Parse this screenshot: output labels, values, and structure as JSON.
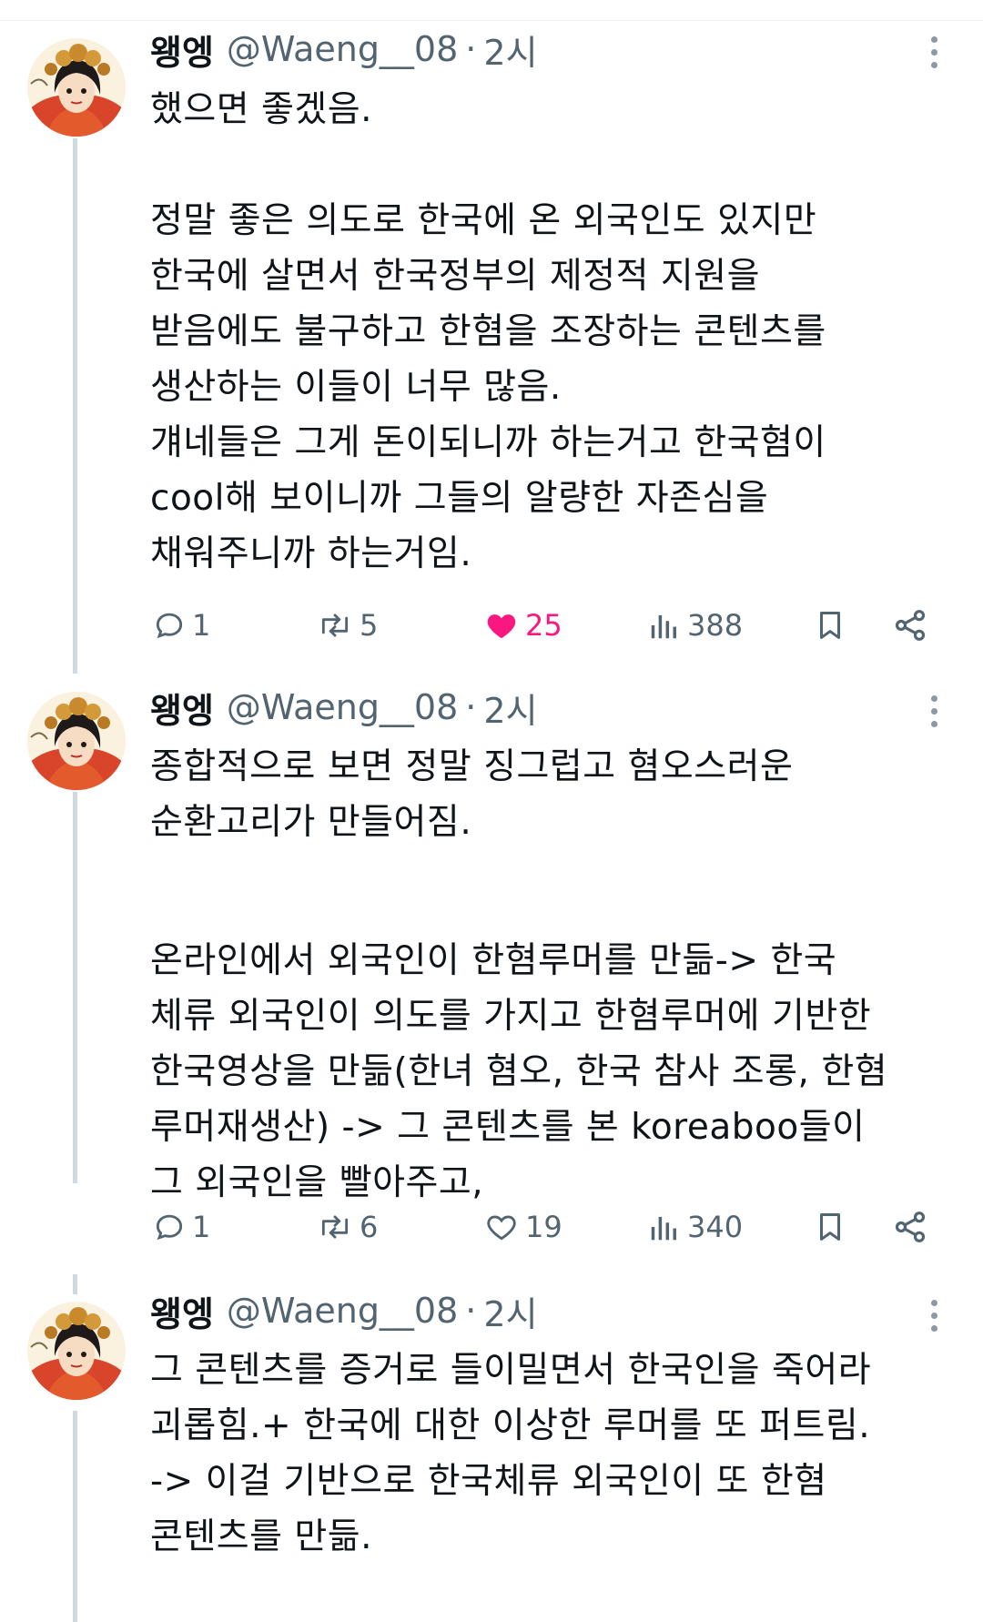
{
  "tweets": [
    {
      "author": {
        "name": "왱엥",
        "handle": "@Waeng__08",
        "separator": "·",
        "time": "2시"
      },
      "lines": [
        "했으면 좋겠음.",
        "",
        "정말 좋은 의도로 한국에 온 외국인도 있지만",
        "한국에 살면서 한국정부의 제정적 지원을",
        "받음에도 불구하고 한혐을 조장하는 콘텐츠를",
        "생산하는 이들이 너무 많음.",
        "걔네들은 그게 돈이되니까 하는거고 한국혐이",
        "cool해 보이니까 그들의 알량한 자존심을",
        "채워주니까 하는거임."
      ],
      "stats": {
        "replies": "1",
        "reposts": "5",
        "likes": "25",
        "views": "388"
      },
      "liked": true
    },
    {
      "author": {
        "name": "왱엥",
        "handle": "@Waeng__08",
        "separator": "·",
        "time": "2시"
      },
      "lines": [
        "종합적으로 보면 정말 징그럽고 혐오스러운",
        "순환고리가 만들어짐.",
        "",
        "온라인에서 외국인이 한혐루머를 만듦-> 한국",
        "체류 외국인이 의도를 가지고 한혐루머에 기반한",
        "한국영상을 만듦(한녀 혐오, 한국 참사 조롱, 한혐",
        "루머재생산) -> 그 콘텐츠를 본 koreaboo들이",
        "그 외국인을 빨아주고,"
      ],
      "stats": {
        "replies": "1",
        "reposts": "6",
        "likes": "19",
        "views": "340"
      },
      "liked": false
    },
    {
      "author": {
        "name": "왱엥",
        "handle": "@Waeng__08",
        "separator": "·",
        "time": "2시"
      },
      "lines": [
        "그 콘텐츠를 증거로 들이밀면서 한국인을 죽어라",
        "괴롭힘.+ 한국에 대한  이상한 루머를 또 퍼트림.",
        "-> 이걸 기반으로 한국체류 외국인이 또 한혐",
        "콘텐츠를 만듦."
      ]
    }
  ],
  "icons": {
    "reply": "speech-bubble-icon",
    "repost": "repost-arrows-icon",
    "like": "heart-icon",
    "views": "bar-chart-icon",
    "bookmark": "bookmark-icon",
    "share": "share-nodes-icon",
    "more": "more-dots-icon"
  },
  "colors": {
    "like_active": "#f91880",
    "secondary_text": "#536471",
    "thread_line": "#cfd9de"
  }
}
